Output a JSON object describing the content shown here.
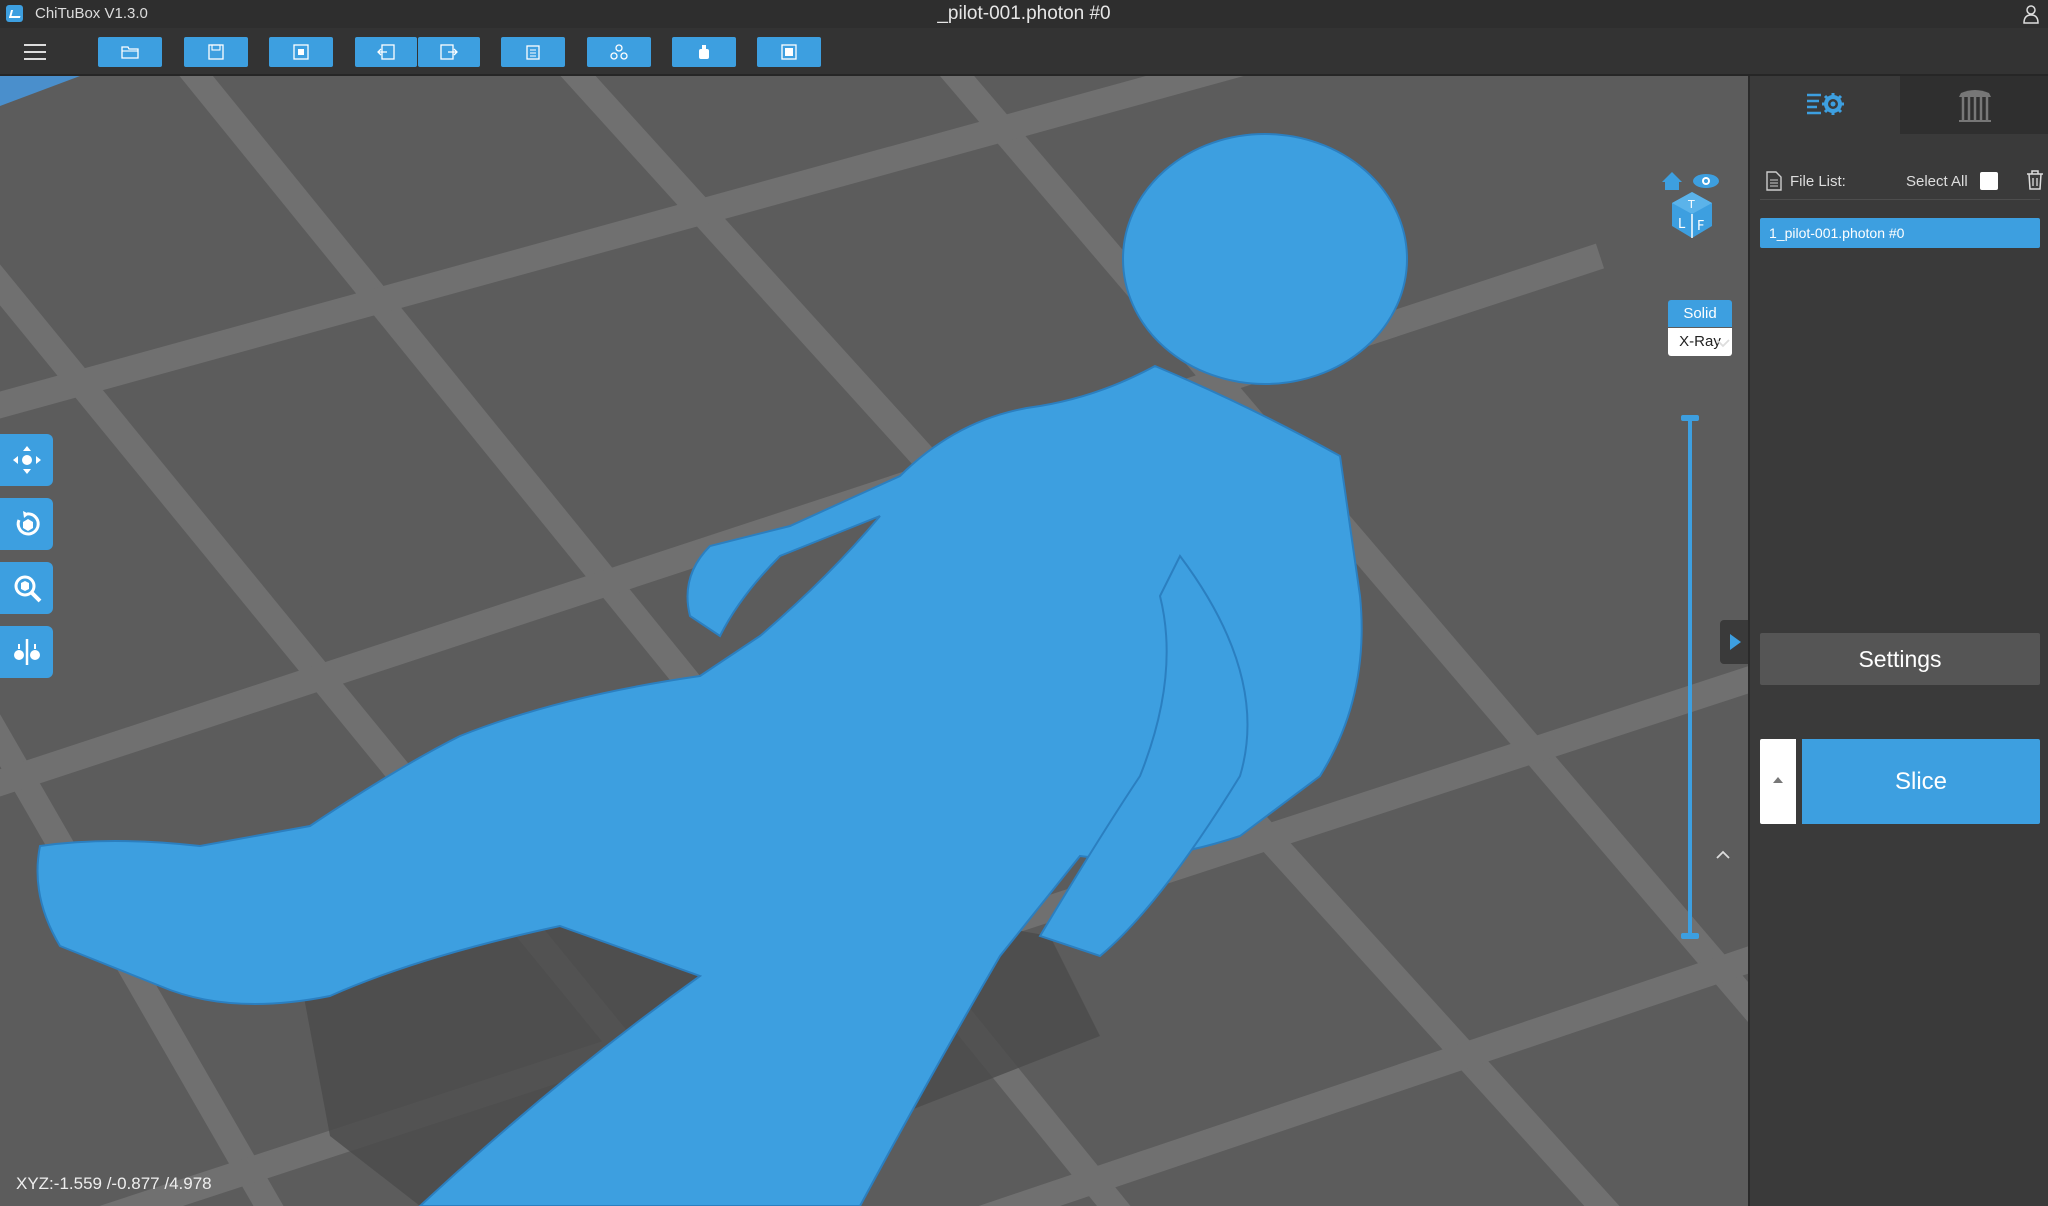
{
  "titlebar": {
    "app_name": "ChiTuBox V1.3.0",
    "window_title": "_pilot-001.photon #0",
    "icons": {
      "app": "chitubox-logo",
      "user": "user-icon"
    }
  },
  "toolbar": {
    "buttons": [
      {
        "name": "open-file-button",
        "icon": "folder-open-icon"
      },
      {
        "name": "save-button",
        "icon": "save-icon"
      },
      {
        "name": "screenshot-button",
        "icon": "screenshot-icon"
      },
      {
        "name": "undo-button",
        "icon": "undo-icon"
      },
      {
        "name": "redo-button",
        "icon": "redo-icon"
      },
      {
        "name": "clipboard-button",
        "icon": "clipboard-icon"
      },
      {
        "name": "arrange-button",
        "icon": "arrange-icon"
      },
      {
        "name": "hollow-button",
        "icon": "bottle-icon"
      },
      {
        "name": "machine-button",
        "icon": "machine-icon"
      }
    ]
  },
  "viewport": {
    "xyz_readout": "XYZ:-1.559 /-0.877 /4.978",
    "left_tools": [
      "move-icon",
      "rotate-icon",
      "scale-icon",
      "mirror-icon"
    ],
    "view_modes": {
      "solid": "Solid",
      "xray": "X-Ray",
      "selected": "solid"
    },
    "colors": {
      "model": "#3d9fe0",
      "accent": "#3d9fe0",
      "floor": "#5c5c5c",
      "grid": "#6f6f6f"
    }
  },
  "right_panel": {
    "tabs": [
      {
        "name": "settings-tab",
        "icon": "list-gear-icon",
        "active": true
      },
      {
        "name": "supports-tab",
        "icon": "supports-icon",
        "active": false
      }
    ],
    "file_list_label": "File List:",
    "select_all_label": "Select All",
    "select_all_checked": false,
    "files": [
      "1_pilot-001.photon #0"
    ],
    "settings_label": "Settings",
    "slice_label": "Slice"
  }
}
